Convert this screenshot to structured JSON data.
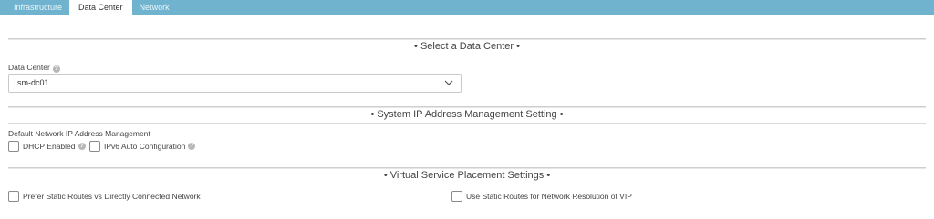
{
  "tabs": [
    {
      "label": "Infrastructure",
      "active": false
    },
    {
      "label": "Data Center",
      "active": true
    },
    {
      "label": "Network",
      "active": false
    }
  ],
  "sections": {
    "data_center": "• Select a Data Center •",
    "ip_management": "• System IP Address Management Setting •",
    "placement": "• Virtual Service Placement Settings •"
  },
  "data_center_field": {
    "label": "Data Center",
    "value": "sm-dc01",
    "help_icon": "question-circle-icon",
    "dropdown_icon": "chevron-down-icon"
  },
  "ip_management": {
    "label": "Default Network IP Address Management",
    "dhcp": {
      "label": "DHCP Enabled",
      "checked": false
    },
    "ipv6": {
      "label": "IPv6 Auto Configuration",
      "checked": false
    }
  },
  "placement": {
    "prefer_static": {
      "label": "Prefer Static Routes vs Directly Connected Network",
      "checked": false
    },
    "use_static": {
      "label": "Use Static Routes for Network Resolution of VIP",
      "checked": false
    }
  },
  "colors": {
    "tabbar": "#6fb3cf",
    "active_tab": "#ffffff",
    "border": "#cfcfcf"
  }
}
